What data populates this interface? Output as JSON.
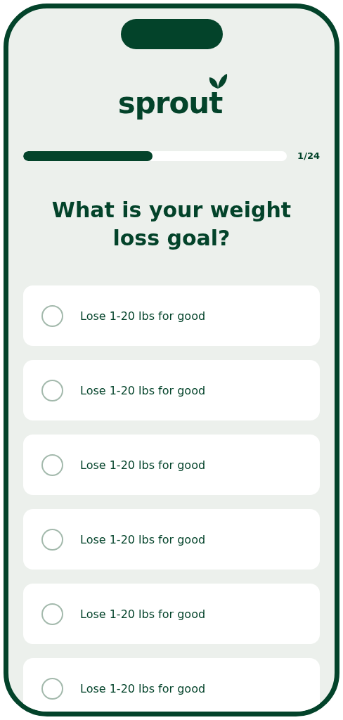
{
  "app": {
    "logo": "sprout"
  },
  "progress": {
    "level": 0.49,
    "label": "1/24"
  },
  "question": "What is your weight loss goal?",
  "options": [
    {
      "label": "Lose 1-20 lbs for good",
      "selected": false
    },
    {
      "label": "Lose 1-20 lbs for good",
      "selected": false
    },
    {
      "label": "Lose 1-20 lbs for good",
      "selected": false
    },
    {
      "label": "Lose 1-20 lbs for good",
      "selected": false
    },
    {
      "label": "Lose 1-20 lbs for good",
      "selected": false
    },
    {
      "label": "Lose 1-20 lbs for good",
      "selected": false
    }
  ]
}
